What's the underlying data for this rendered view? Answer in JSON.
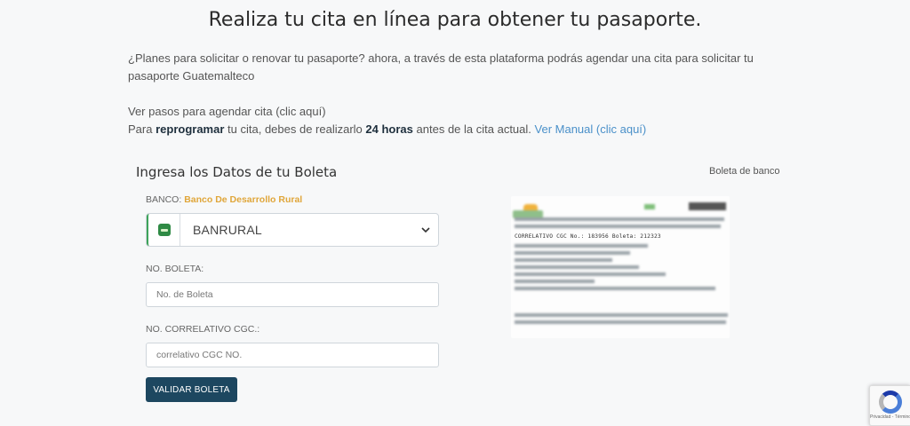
{
  "header": {
    "title": "Realiza tu cita en línea para obtener tu pasaporte."
  },
  "intro": {
    "text": "¿Planes para solicitar o renovar tu pasaporte? ahora, a través de esta plataforma podrás agendar una cita para solicitar tu pasaporte Guatemalteco"
  },
  "steps": {
    "link_text": "Ver pasos para agendar cita (clic aquí)",
    "reschedule_prefix": "Para",
    "reschedule_bold": "reprogramar",
    "reschedule_mid": "tu cita, debes de realizarlo",
    "hours_bold": "24 horas",
    "reschedule_suffix": "antes de la cita actual.",
    "manual_link": "Ver Manual (clic aquí)"
  },
  "form": {
    "heading": "Ingresa los Datos de tu Boleta",
    "bank_label": "BANCO:",
    "bank_name": "Banco De Desarrollo Rural",
    "bank_select_value": "BANRURAL",
    "boleta_label": "NO. BOLETA:",
    "boleta_placeholder": "No. de Boleta",
    "cgc_label": "NO. CORRELATIVO CGC.:",
    "cgc_placeholder": "correlativo CGC NO.",
    "submit_label": "VALIDAR BOLETA"
  },
  "receipt": {
    "label": "Boleta de banco",
    "visible_line": "CORRELATIVO CGC No.: 183956  Boleta: 212323"
  },
  "recaptcha": {
    "text": "Privacidad - Términos",
    "icon": "recaptcha-icon"
  },
  "colors": {
    "accent_button": "#1d4760",
    "link": "#4a90c9",
    "bank_name": "#e0a63a",
    "bank_logo": "#2f8a45"
  }
}
